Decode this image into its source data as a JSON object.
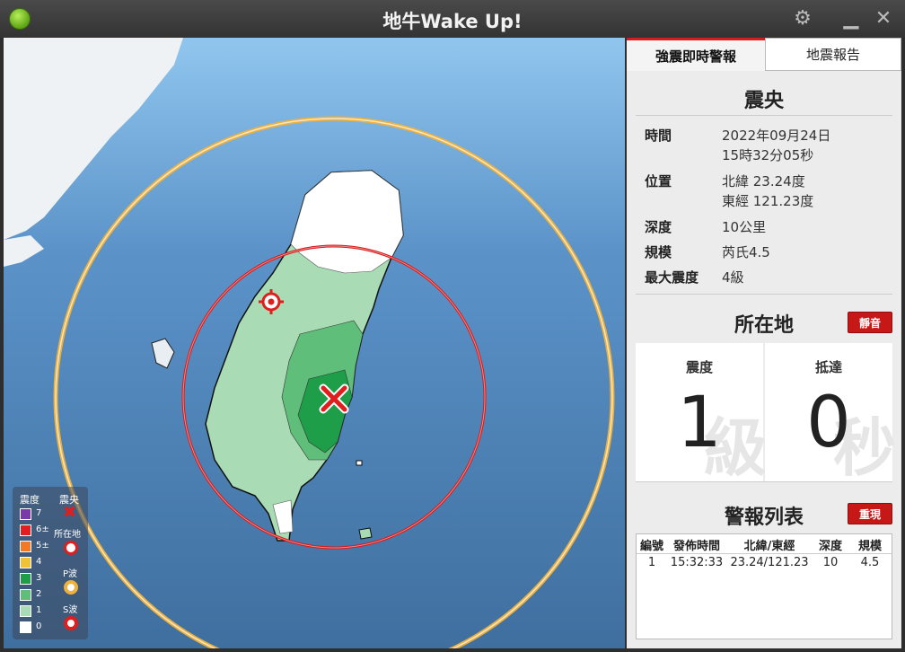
{
  "window": {
    "title": "地牛Wake Up!"
  },
  "tabs": [
    {
      "label": "強震即時警報",
      "active": true
    },
    {
      "label": "地震報告",
      "active": false
    }
  ],
  "epicenter": {
    "heading": "震央",
    "time_label": "時間",
    "time_date": "2022年09月24日",
    "time_clock": "15時32分05秒",
    "location_label": "位置",
    "lat": "北緯 23.24度",
    "lon": "東經 121.23度",
    "depth_label": "深度",
    "depth": "10公里",
    "magnitude_label": "規模",
    "magnitude": "芮氏4.5",
    "max_intensity_label": "最大震度",
    "max_intensity": "4級"
  },
  "location": {
    "heading": "所在地",
    "mute_button": "靜音",
    "intensity_label": "震度",
    "intensity_value": "1",
    "intensity_watermark": "級",
    "arrival_label": "抵達",
    "arrival_value": "0",
    "arrival_watermark": "秒"
  },
  "alerts": {
    "heading": "警報列表",
    "replay_button": "重現",
    "columns": [
      "編號",
      "發佈時間",
      "北緯/東經",
      "深度",
      "規模"
    ],
    "rows": [
      [
        "1",
        "15:32:33",
        "23.24/121.23",
        "10",
        "4.5"
      ]
    ]
  },
  "legend": {
    "intensity_header": "震度",
    "epicenter_header": "震央",
    "levels": [
      {
        "label": "7",
        "color": "#7a3aa8"
      },
      {
        "label": "6±",
        "color": "#e02020"
      },
      {
        "label": "5±",
        "color": "#f07a2a"
      },
      {
        "label": "4",
        "color": "#f0c23a"
      },
      {
        "label": "3",
        "color": "#1f9e4a"
      },
      {
        "label": "2",
        "color": "#5fbf7a"
      },
      {
        "label": "1",
        "color": "#a9dcb4"
      },
      {
        "label": "0",
        "color": "#ffffff"
      }
    ],
    "location_label": "所在地",
    "p_wave_label": "P波",
    "s_wave_label": "S波"
  },
  "colors": {
    "accent": "#d21e1e",
    "p_wave": "#f0b13a",
    "s_wave": "#d71a1a"
  }
}
